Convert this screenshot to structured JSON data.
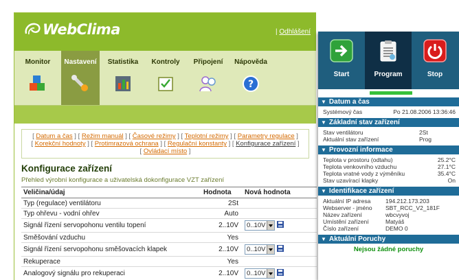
{
  "app": {
    "logo_text": "WebClima",
    "logout": "Odhlášení"
  },
  "nav": [
    {
      "label": "Monitor",
      "icon": "cubes-icon"
    },
    {
      "label": "Nastavení",
      "icon": "wrench-icon",
      "active": true
    },
    {
      "label": "Statistika",
      "icon": "chart-icon"
    },
    {
      "label": "Kontroly",
      "icon": "checklist-icon"
    },
    {
      "label": "Připojení",
      "icon": "users-icon"
    },
    {
      "label": "Nápověda",
      "icon": "help-icon"
    }
  ],
  "links": {
    "l1": "Datum a čas",
    "l2": "Režim manuál",
    "l3": "Časové režimy",
    "l4": "Teplotní režimy",
    "l5": "Parametry regulace",
    "l6": "Korekční hodnoty",
    "l7": "Protimrazová ochrana",
    "l8": "Regulační konstanty",
    "l9": "Konfigurace zařízení",
    "l10": "Ovládací místo"
  },
  "page": {
    "title": "Konfigurace zařízení",
    "subtitle": "Přehled výrobní konfigurace a uživatelská dokonfigurace VZT zařízení"
  },
  "table": {
    "headers": {
      "name": "Veličina/údaj",
      "value": "Hodnota",
      "new": "Nová hodnota"
    },
    "rows": [
      {
        "name": "Typ (regulace) ventilátoru",
        "value": "2St"
      },
      {
        "name": "Typ ohřevu - vodní ohřev",
        "value": "Auto"
      },
      {
        "name": "Signál řízení servopohonu ventilu topení",
        "value": "2..10V",
        "select": "0..10V"
      },
      {
        "name": "Směšování vzduchu",
        "value": "Yes"
      },
      {
        "name": "Signál řízení servopohonu směšovacích klapek",
        "value": "2..10V",
        "select": "0..10V"
      },
      {
        "name": "Rekuperace",
        "value": "Yes"
      },
      {
        "name": "Analogový signálu pro rekuperaci",
        "value": "2..10V",
        "select": "0..10V"
      }
    ]
  },
  "panel": {
    "buttons": {
      "start": "Start",
      "program": "Program",
      "stop": "Stop"
    },
    "progress": 0.3,
    "datetime": {
      "title": "Datum a čas",
      "k1": "Systémový čas",
      "v1": "Po 21.08.2006 13:36:46"
    },
    "state": {
      "title": "Základní stav zařízení",
      "k1": "Stav ventilátoru",
      "v1": "2St",
      "k2": "Aktuální stav zařízení",
      "v2": "Prog"
    },
    "info": {
      "title": "Provozní informace",
      "k1": "Teplota v prostoru (odtahu)",
      "v1": "25.2°C",
      "k2": "Teplota venkovního vzduchu",
      "v2": "27.1°C",
      "k3": "Teplota vratné vody z výměníku",
      "v3": "35.4°C",
      "k4": "Stav uzavírací klapky",
      "v4": "On"
    },
    "ident": {
      "title": "Identifikace zařízení",
      "k1": "Aktuální IP adresa",
      "v1": "194.212.173.203",
      "k2": "Webserver - jméno",
      "v2": "SBT_RCC_V2_181F",
      "k3": "Název zařízení",
      "v3": "wbcvyvoj",
      "k4": "Umístění zařízení",
      "v4": "Matyáš",
      "k5": "Číslo zařízení",
      "v5": "DEMO 0"
    },
    "faults": {
      "title": "Aktuální Poruchy",
      "message": "Nejsou žádné poruchy"
    }
  },
  "colors": {
    "green": "#8dba2b",
    "panel_blue": "#1f6c98",
    "ok_green": "#109010"
  }
}
